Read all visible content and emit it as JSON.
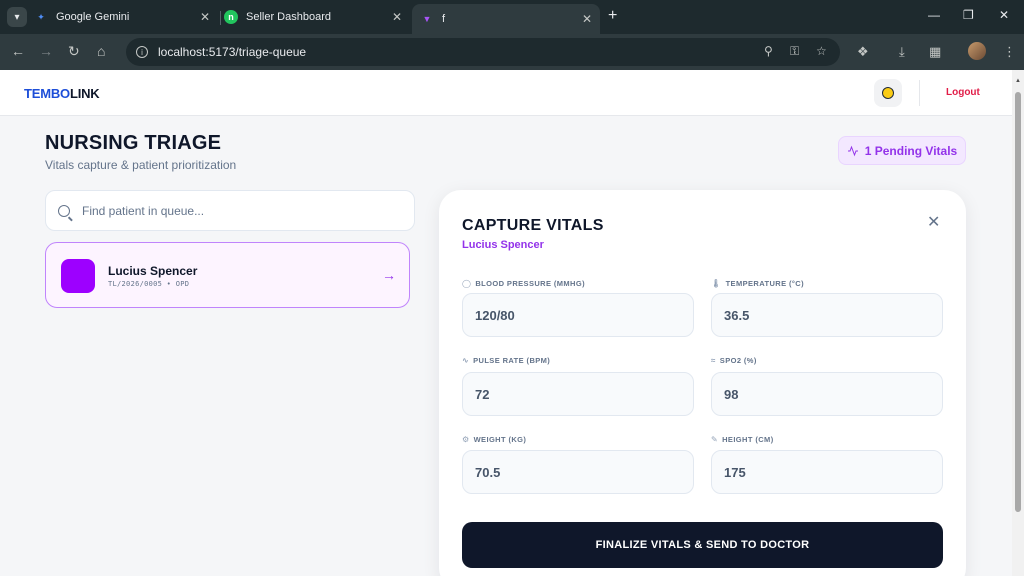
{
  "browser": {
    "tabs": [
      {
        "label": "Google Gemini",
        "icon": "gemini-icon"
      },
      {
        "label": "Seller Dashboard",
        "icon": "seller-dashboard-icon"
      },
      {
        "label": "f",
        "icon": "vite-icon"
      }
    ],
    "url": "localhost:5173/triage-queue"
  },
  "header": {
    "logo_part1": "TEMBO",
    "logo_part2": "LINK",
    "logout_label": "Logout"
  },
  "page": {
    "title": "NURSING TRIAGE",
    "subtitle": "Vitals capture & patient prioritization",
    "pending_label": "1 Pending Vitals"
  },
  "search": {
    "placeholder": "Find patient in queue..."
  },
  "queue": [
    {
      "name": "Lucius Spencer",
      "meta": "TL/2026/0005 • OPD",
      "avatar_color": "#9d00ff"
    }
  ],
  "vitals": {
    "title": "CAPTURE VITALS",
    "patient": "Lucius Spencer",
    "fields": [
      {
        "label": "BLOOD PRESSURE (MMHG)",
        "value": "120/80",
        "icon": "gauge-icon"
      },
      {
        "label": "TEMPERATURE (°C)",
        "value": "36.5",
        "icon": "thermometer-icon"
      },
      {
        "label": "PULSE RATE (BPM)",
        "value": "72",
        "icon": "pulse-icon"
      },
      {
        "label": "SPO2 (%)",
        "value": "98",
        "icon": "wind-icon"
      },
      {
        "label": "WEIGHT (KG)",
        "value": "70.5",
        "icon": "scale-icon"
      },
      {
        "label": "HEIGHT (CM)",
        "value": "175",
        "icon": "ruler-icon"
      }
    ],
    "finalize_label": "FINALIZE VITALS & SEND TO DOCTOR"
  },
  "colors": {
    "accent": "#9333ea",
    "brand_blue": "#1d4ed8",
    "logout": "#e11d48",
    "dark": "#0f172a"
  }
}
